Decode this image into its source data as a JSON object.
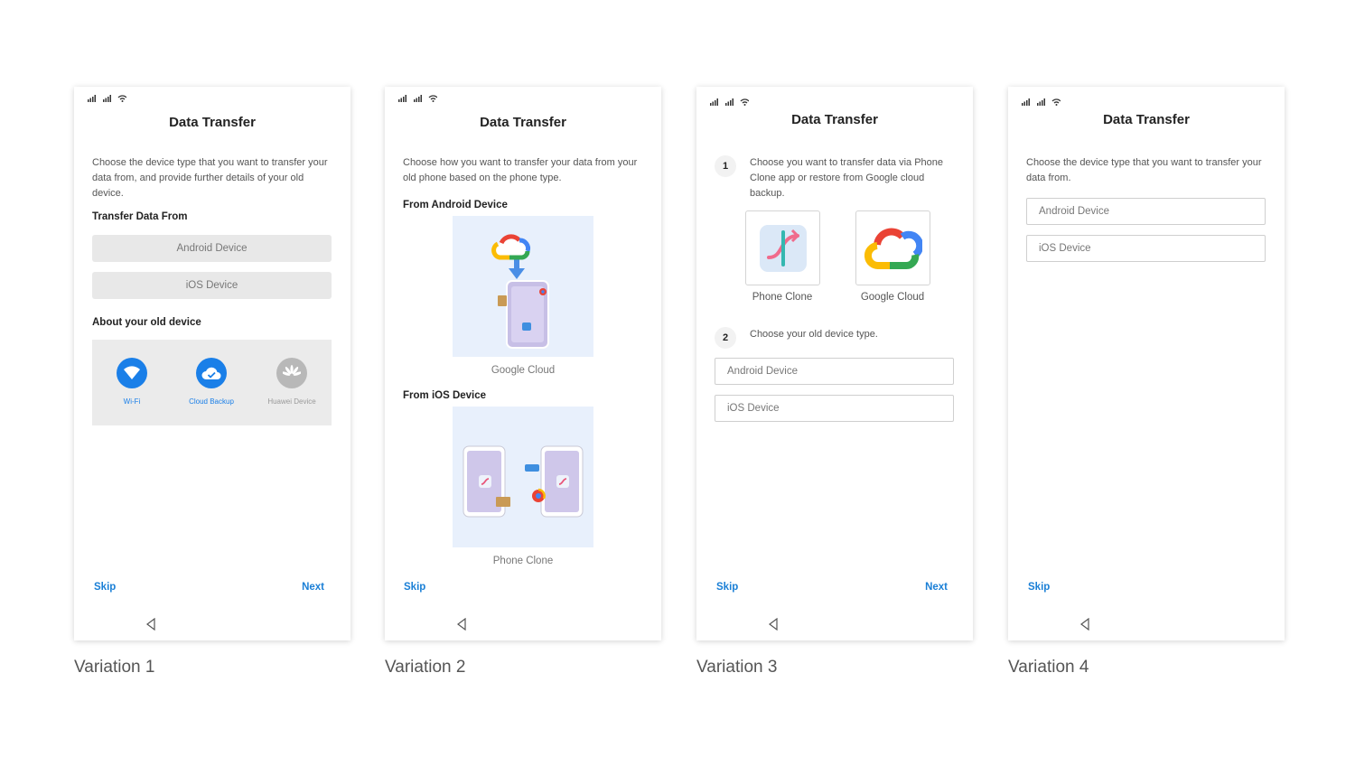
{
  "status_bar": {
    "text": "⁴ᐧıl ⁴ᐧıl"
  },
  "variations": [
    {
      "caption": "Variation 1",
      "title": "Data Transfer",
      "description": "Choose the device type that you want to transfer your data from, and provide further details of your old device.",
      "transfer_from_heading": "Transfer Data From",
      "android_button": "Android Device",
      "ios_button": "iOS Device",
      "about_heading": "About your old device",
      "options": [
        {
          "label": "Wi-Fi",
          "icon": "wifi-icon",
          "color": "#1a7fe8"
        },
        {
          "label": "Cloud Backup",
          "icon": "cloud-check-icon",
          "color": "#1a7fe8"
        },
        {
          "label": "Huawei Device",
          "icon": "huawei-logo-icon",
          "color": "#9a9a9a"
        }
      ],
      "skip": "Skip",
      "next": "Next"
    },
    {
      "caption": "Variation 2",
      "title": "Data Transfer",
      "description": "Choose how you want to transfer your data from your old phone based on the phone type.",
      "from_android_heading": "From Android Device",
      "google_cloud_label": "Google Cloud",
      "from_ios_heading": "From iOS Device",
      "phone_clone_label": "Phone Clone",
      "skip": "Skip"
    },
    {
      "caption": "Variation 3",
      "title": "Data Transfer",
      "step1_number": "1",
      "step1_text": "Choose you want to transfer data via Phone Clone app or restore from Google cloud backup.",
      "phone_clone_label": "Phone Clone",
      "google_cloud_label": "Google Cloud",
      "step2_number": "2",
      "step2_text": "Choose your old device type.",
      "android_button": "Android Device",
      "ios_button": "iOS Device",
      "skip": "Skip",
      "next": "Next"
    },
    {
      "caption": "Variation 4",
      "title": "Data Transfer",
      "description": "Choose the device type that you want to transfer your data from.",
      "android_button": "Android Device",
      "ios_button": "iOS Device",
      "skip": "Skip"
    }
  ],
  "colors": {
    "accent": "#1a7fd6",
    "panel_gray": "#ebebeb",
    "illustration_bg": "#e8f0fc"
  }
}
